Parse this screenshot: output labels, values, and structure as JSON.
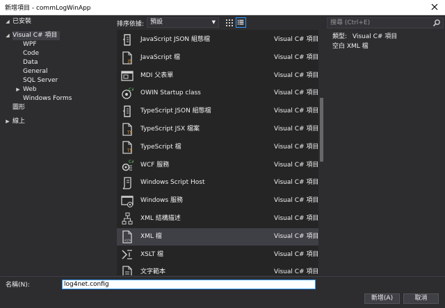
{
  "window": {
    "title": "新增項目 - commLogWinApp"
  },
  "tree": {
    "items": [
      {
        "label": "已安裝",
        "indent": 0,
        "arrow": "◢"
      },
      {
        "label": "Visual C# 項目",
        "indent": 1,
        "arrow": "◢",
        "selected": true
      },
      {
        "label": "WPF",
        "indent": 2,
        "arrow": ""
      },
      {
        "label": "Code",
        "indent": 2,
        "arrow": ""
      },
      {
        "label": "Data",
        "indent": 2,
        "arrow": ""
      },
      {
        "label": "General",
        "indent": 2,
        "arrow": ""
      },
      {
        "label": "SQL Server",
        "indent": 2,
        "arrow": ""
      },
      {
        "label": "Web",
        "indent": 2,
        "arrow": "▶"
      },
      {
        "label": "Windows Forms",
        "indent": 2,
        "arrow": ""
      },
      {
        "label": "圖形",
        "indent": 1,
        "arrow": ""
      },
      {
        "label": "線上",
        "indent": 0,
        "arrow": "▶"
      }
    ]
  },
  "sort": {
    "label": "排序依據:",
    "value": "預設"
  },
  "templates": [
    {
      "name": "JavaScript JSON 組態檔",
      "kind": "Visual C# 項目",
      "icon": "json-config-icon"
    },
    {
      "name": "JavaScript 檔",
      "kind": "Visual C# 項目",
      "icon": "javascript-file-icon"
    },
    {
      "name": "MDI 父表單",
      "kind": "Visual C# 項目",
      "icon": "mdi-form-icon"
    },
    {
      "name": "OWIN Startup class",
      "kind": "Visual C# 項目",
      "icon": "owin-class-icon"
    },
    {
      "name": "TypeScript JSON 組態檔",
      "kind": "Visual C# 項目",
      "icon": "json-config-icon"
    },
    {
      "name": "TypeScript JSX 檔案",
      "kind": "Visual C# 項目",
      "icon": "typescript-file-icon"
    },
    {
      "name": "TypeScript 檔",
      "kind": "Visual C# 項目",
      "icon": "typescript-file-icon"
    },
    {
      "name": "WCF 服務",
      "kind": "Visual C# 項目",
      "icon": "wcf-service-icon"
    },
    {
      "name": "Windows Script Host",
      "kind": "Visual C# 項目",
      "icon": "script-host-icon"
    },
    {
      "name": "Windows 服務",
      "kind": "Visual C# 項目",
      "icon": "windows-service-icon"
    },
    {
      "name": "XML 結構描述",
      "kind": "Visual C# 項目",
      "icon": "xml-schema-icon"
    },
    {
      "name": "XML 檔",
      "kind": "Visual C# 項目",
      "icon": "xml-file-icon",
      "selected": true
    },
    {
      "name": "XSLT 檔",
      "kind": "Visual C# 項目",
      "icon": "xslt-file-icon"
    },
    {
      "name": "文字範本",
      "kind": "Visual C# 項目",
      "icon": "text-template-icon"
    }
  ],
  "search": {
    "placeholder": "搜尋 (Ctrl+E)"
  },
  "details": {
    "type_label": "類型:",
    "type_value": "Visual C# 項目",
    "description": "空白 XML 檔"
  },
  "bottom": {
    "name_label": "名稱(N):",
    "name_value": "log4net.config",
    "add_label": "新增(A)",
    "cancel_label": "取消"
  },
  "colors": {
    "background": "#2d2d30",
    "list_background": "#252526",
    "selection": "#3f3f46",
    "accent": "#3399ff",
    "text": "#f1f1f1"
  }
}
